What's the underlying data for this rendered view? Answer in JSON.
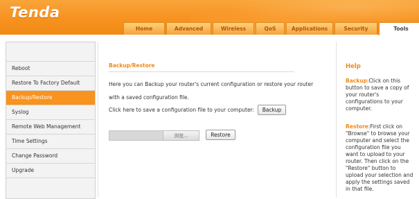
{
  "brand": {
    "logo": "Tenda",
    "accent": "#f7931e"
  },
  "tabs": [
    {
      "label": "Home",
      "active": false
    },
    {
      "label": "Advanced",
      "active": false
    },
    {
      "label": "Wireless",
      "active": false
    },
    {
      "label": "QoS",
      "active": false
    },
    {
      "label": "Applications",
      "active": false
    },
    {
      "label": "Security",
      "active": false
    },
    {
      "label": "Tools",
      "active": true
    }
  ],
  "sidebar": {
    "items": [
      {
        "label": "Reboot",
        "active": false
      },
      {
        "label": "Restore To Factory Default",
        "active": false
      },
      {
        "label": "Backup/Restore",
        "active": true
      },
      {
        "label": "Syslog",
        "active": false
      },
      {
        "label": "Remote Web Management",
        "active": false
      },
      {
        "label": "Time Settings",
        "active": false
      },
      {
        "label": "Change Password",
        "active": false
      },
      {
        "label": "Upgrade",
        "active": false
      }
    ]
  },
  "main": {
    "title": "Backup/Restore",
    "description_line1": "Here you can Backup your router's current configuration or restore your router",
    "description_line2": "with a saved configuration file.",
    "backup_prompt": "Click here to save a configuration file to your computer:",
    "backup_button": "Backup",
    "file_input_value": "",
    "browse_button": "浏览...",
    "restore_button": "Restore"
  },
  "help": {
    "title": "Help",
    "backup_keyword": "Backup",
    "backup_text": ":Click on this button to save a copy of your router's configurations to your computer.",
    "restore_keyword": "Restore",
    "restore_text": ":First click on \"Browse\" to browse your computer and select the configuration file you want to upload to your router. Then click on the \"Restore\" button to upload your selection and apply the settings saved in that file."
  }
}
